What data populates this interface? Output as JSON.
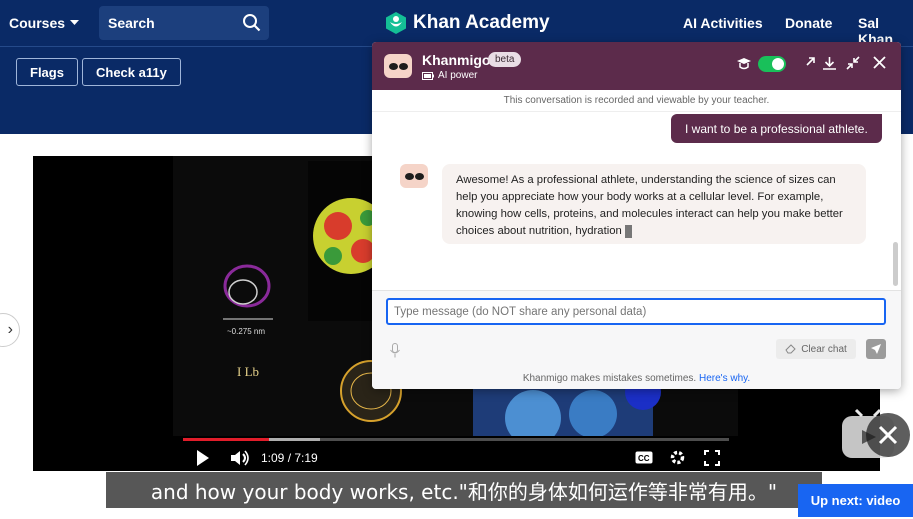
{
  "header": {
    "courses_label": "Courses",
    "search_label": "Search",
    "brand": "Khan Academy",
    "nav": [
      "AI Activities",
      "Donate",
      "Sal Khan"
    ]
  },
  "toolbar": {
    "flags_label": "Flags",
    "check_label": "Check a11y"
  },
  "video": {
    "time": "1:09 / 7:19",
    "progress_fraction": 0.157,
    "caption": "and how your body works, etc.\"和你的身体如何运作等非常有用。\"",
    "up_next": "Up next: video"
  },
  "khanmigo": {
    "title": "Khanmigo",
    "beta": "beta",
    "power": "AI power",
    "notice": "This conversation is recorded and viewable by your teacher.",
    "user_message": "I want to be a professional athlete.",
    "bot_message": "Awesome! As a professional athlete, understanding the science of sizes can help you appreciate how your body works at a cellular level. For example, knowing how cells, proteins, and molecules interact can help you make better choices about nutrition, hydration",
    "input_placeholder": "Type message (do NOT share any personal data)",
    "clear_label": "Clear chat",
    "disclaimer": "Khanmigo makes mistakes sometimes.",
    "disclaimer_link": "Here's why."
  },
  "colors": {
    "nav_bg": "#0a2a66",
    "panel_header": "#5c2b4b",
    "accent_blue": "#1865f2",
    "toggle_on": "#19c05a"
  }
}
